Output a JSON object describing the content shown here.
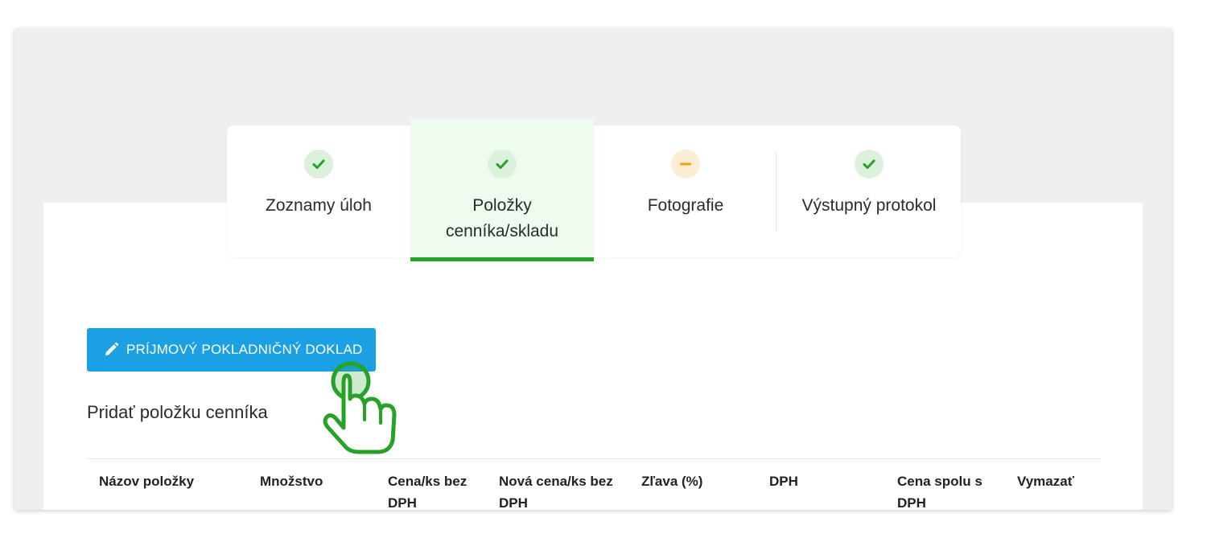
{
  "stepper": {
    "steps": [
      {
        "label": "Zoznamy úloh",
        "status": "done",
        "icon": "check-icon"
      },
      {
        "label": "Položky cenníka/skladu",
        "status": "done",
        "icon": "check-icon",
        "active": true
      },
      {
        "label": "Fotografie",
        "status": "pending",
        "icon": "minus-icon"
      },
      {
        "label": "Výstupný protokol",
        "status": "done",
        "icon": "check-icon"
      }
    ]
  },
  "actions": {
    "receipt_button_label": "PRÍJMOVÝ POKLADNIČNÝ DOKLAD",
    "receipt_button_icon": "pencil-icon"
  },
  "section": {
    "title": "Pridať položku cenníka"
  },
  "table": {
    "headers": [
      "Názov položky",
      "Množstvo",
      "Cena/ks bez DPH",
      "Nová cena/ks bez DPH",
      "Zľava (%)",
      "DPH",
      "Cena spolu s DPH",
      "Vymazať"
    ]
  },
  "colors": {
    "success": "#26a326",
    "warning": "#f0a30a",
    "primary_button": "#1aa0e3",
    "active_step_bg": "#eefbee"
  },
  "cursor": {
    "icon": "hand-pointer-icon"
  }
}
